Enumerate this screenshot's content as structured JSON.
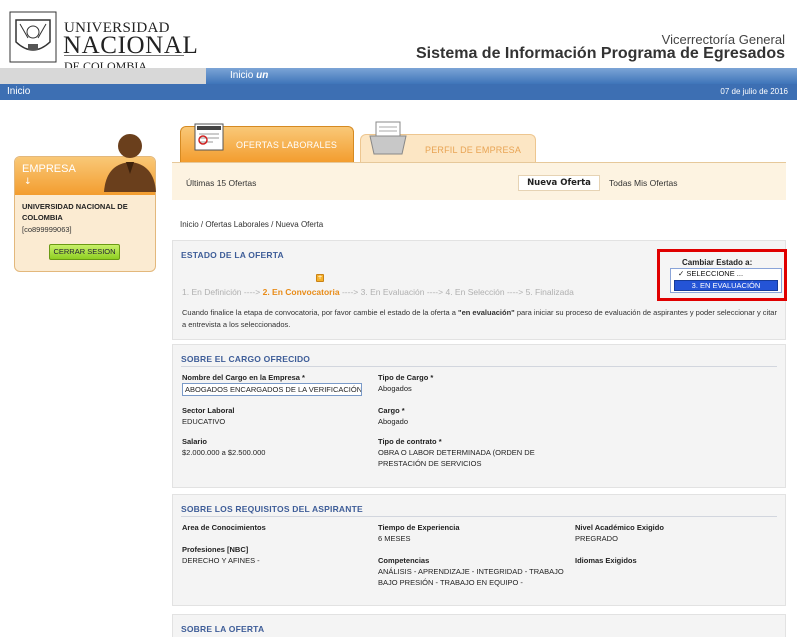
{
  "header": {
    "university_line1": "UNIVERSIDAD",
    "university_line2": "NACIONAL",
    "university_line3": "DE COLOMBIA",
    "vicerrectoria": "Vicerrectoría General",
    "system_name": "Sistema de Información Programa de Egresados",
    "nav_tab": "Inicio",
    "nav_tab_logo": "un",
    "home_link": "Inicio",
    "date": "07 de julio de 2016"
  },
  "sidebar": {
    "title": "EMPRESA",
    "arrow": "↓",
    "company_name": "UNIVERSIDAD NACIONAL DE COLOMBIA",
    "company_code": "[co899999063]",
    "logout_label": "CERRAR SESION"
  },
  "tabs": {
    "ofertas": "OFERTAS LABORALES",
    "perfil": "PERFIL DE EMPRESA"
  },
  "subnav": {
    "last15": "Últimas 15 Ofertas",
    "new_offer": "Nueva Oferta",
    "all_offers": "Todas Mis Ofertas"
  },
  "breadcrumb": "Inicio / Ofertas Laborales / Nueva Oferta",
  "estado": {
    "title": "ESTADO DE LA OFERTA",
    "step1": "1. En Definición",
    "arrow": "---->",
    "step2": "2. En Convocatoria",
    "step3": "3. En Evaluación",
    "step4": "4. En Selección",
    "step5": "5. Finalizada",
    "note_before": "Cuando finalice la etapa de convocatoria, por favor cambie el estado de la oferta a ",
    "note_bold": "\"en evaluación\"",
    "note_after": " para iniciar su proceso de evaluación de aspirantes y poder seleccionar y citar a entrevista a los seleccionados.",
    "change_label": "Cambiar Estado a:",
    "option_selected": "✓ SELECCIONE ...",
    "option_highlight": "3. EN EVALUACIÓN"
  },
  "cargo": {
    "title": "SOBRE EL CARGO OFRECIDO",
    "nombre_label": "Nombre del Cargo en la Empresa *",
    "nombre_value": "ABOGADOS ENCARGADOS DE LA VERIFICACIÓN",
    "tipo_label": "Tipo de Cargo *",
    "tipo_value": "Abogados",
    "sector_label": "Sector Laboral",
    "sector_value": "EDUCATIVO",
    "cargo_label": "Cargo *",
    "cargo_value": "Abogado",
    "salario_label": "Salario",
    "salario_value": "$2.000.000 a $2.500.000",
    "contrato_label": "Tipo de contrato *",
    "contrato_value": "OBRA O LABOR DETERMINADA (ORDEN DE PRESTACIÓN DE SERVICIOS"
  },
  "requisitos": {
    "title": "SOBRE LOS REQUISITOS DEL ASPIRANTE",
    "area_label": "Area de Conocimientos",
    "experiencia_label": "Tiempo de Experiencia",
    "experiencia_value": "6 MESES",
    "nivel_label": "Nivel Académico Exigido",
    "nivel_value": "PREGRADO",
    "profesiones_label": "Profesiones [NBC]",
    "profesiones_value": "DERECHO Y AFINES -",
    "competencias_label": "Competencias",
    "competencias_value": "ANÁLISIS - APRENDIZAJE - INTEGRIDAD - TRABAJO BAJO PRESIÓN - TRABAJO EN EQUIPO -",
    "idiomas_label": "Idiomas Exigidos"
  },
  "oferta": {
    "title": "SOBRE LA OFERTA"
  },
  "colors": {
    "accent_orange": "#f39d2f",
    "blue_bar": "#3d6fb3",
    "section_title": "#3e5d98",
    "highlight_red": "#e00000"
  }
}
